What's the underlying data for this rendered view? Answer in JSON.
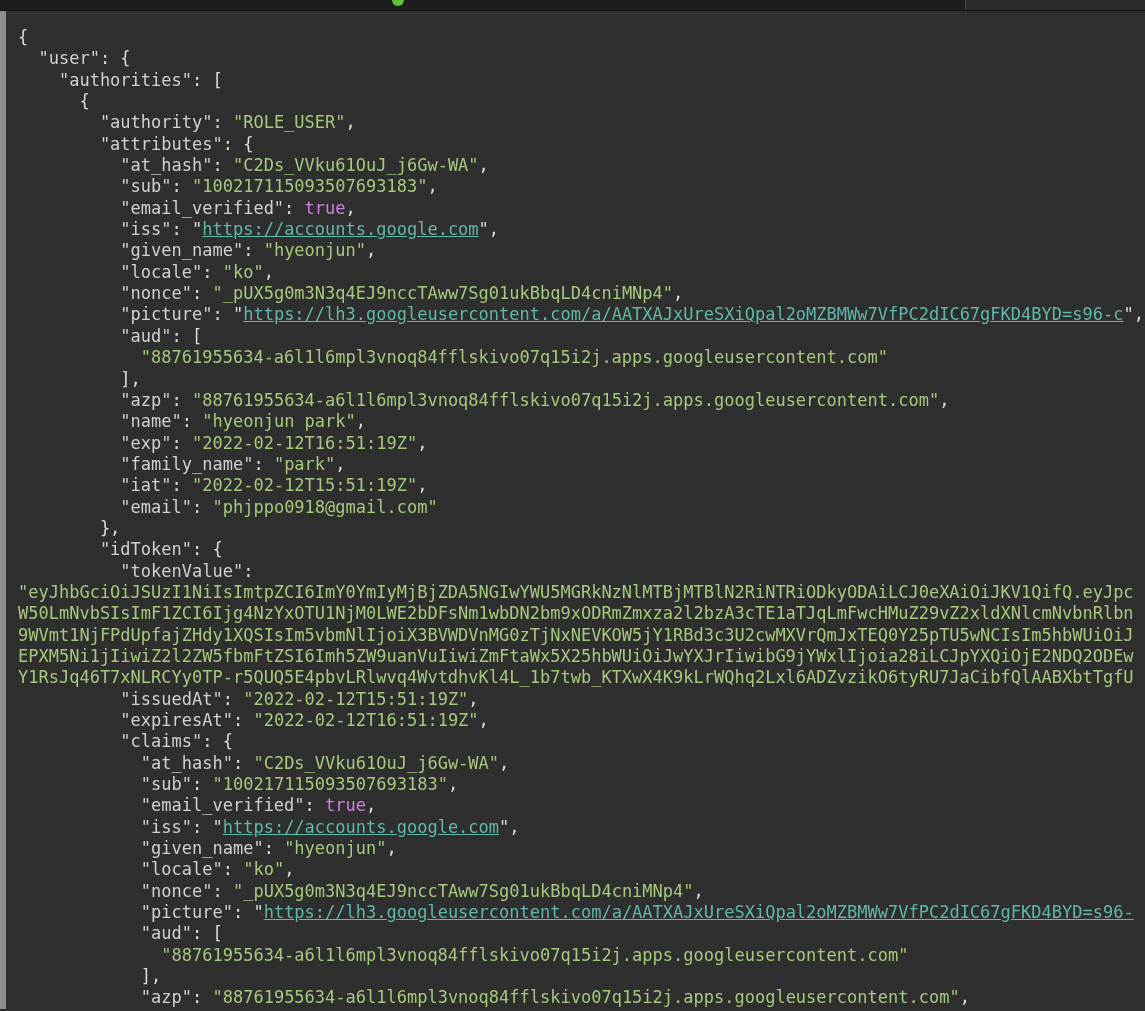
{
  "viewer": {
    "lines": [
      {
        "parts": [
          {
            "kind": "punct",
            "text": "{"
          }
        ],
        "children": [
          {
            "parts": [
              {
                "kind": "key",
                "text": "\"user\""
              },
              {
                "kind": "punct",
                "text": ": {"
              }
            ],
            "children": [
              {
                "parts": [
                  {
                    "kind": "key",
                    "text": "\"authorities\""
                  },
                  {
                    "kind": "punct",
                    "text": ": ["
                  }
                ],
                "children": [
                  {
                    "parts": [
                      {
                        "kind": "punct",
                        "text": "{"
                      }
                    ],
                    "children": [
                      {
                        "parts": [
                          {
                            "kind": "key",
                            "text": "\"authority\""
                          },
                          {
                            "kind": "punct",
                            "text": ": "
                          },
                          {
                            "kind": "string",
                            "text": "\"ROLE_USER\""
                          },
                          {
                            "kind": "punct",
                            "text": ","
                          }
                        ]
                      },
                      {
                        "parts": [
                          {
                            "kind": "key",
                            "text": "\"attributes\""
                          },
                          {
                            "kind": "punct",
                            "text": ": {"
                          }
                        ],
                        "children": [
                          {
                            "parts": [
                              {
                                "kind": "key",
                                "text": "\"at_hash\""
                              },
                              {
                                "kind": "punct",
                                "text": ": "
                              },
                              {
                                "kind": "string",
                                "text": "\"C2Ds_VVku61OuJ_j6Gw-WA\""
                              },
                              {
                                "kind": "punct",
                                "text": ","
                              }
                            ]
                          },
                          {
                            "parts": [
                              {
                                "kind": "key",
                                "text": "\"sub\""
                              },
                              {
                                "kind": "punct",
                                "text": ": "
                              },
                              {
                                "kind": "string",
                                "text": "\"100217115093507693183\""
                              },
                              {
                                "kind": "punct",
                                "text": ","
                              }
                            ]
                          },
                          {
                            "parts": [
                              {
                                "kind": "key",
                                "text": "\"email_verified\""
                              },
                              {
                                "kind": "punct",
                                "text": ": "
                              },
                              {
                                "kind": "bool",
                                "text": "true"
                              },
                              {
                                "kind": "punct",
                                "text": ","
                              }
                            ]
                          },
                          {
                            "parts": [
                              {
                                "kind": "key",
                                "text": "\"iss\""
                              },
                              {
                                "kind": "punct",
                                "text": ": \""
                              },
                              {
                                "kind": "link",
                                "text": "https://accounts.google.com"
                              },
                              {
                                "kind": "punct",
                                "text": "\","
                              }
                            ]
                          },
                          {
                            "parts": [
                              {
                                "kind": "key",
                                "text": "\"given_name\""
                              },
                              {
                                "kind": "punct",
                                "text": ": "
                              },
                              {
                                "kind": "string",
                                "text": "\"hyeonjun\""
                              },
                              {
                                "kind": "punct",
                                "text": ","
                              }
                            ]
                          },
                          {
                            "parts": [
                              {
                                "kind": "key",
                                "text": "\"locale\""
                              },
                              {
                                "kind": "punct",
                                "text": ": "
                              },
                              {
                                "kind": "string",
                                "text": "\"ko\""
                              },
                              {
                                "kind": "punct",
                                "text": ","
                              }
                            ]
                          },
                          {
                            "parts": [
                              {
                                "kind": "key",
                                "text": "\"nonce\""
                              },
                              {
                                "kind": "punct",
                                "text": ": "
                              },
                              {
                                "kind": "string",
                                "text": "\"_pUX5g0m3N3q4EJ9nccTAww7Sg01ukBbqLD4cniMNp4\""
                              },
                              {
                                "kind": "punct",
                                "text": ","
                              }
                            ]
                          },
                          {
                            "parts": [
                              {
                                "kind": "key",
                                "text": "\"picture\""
                              },
                              {
                                "kind": "punct",
                                "text": ": \""
                              },
                              {
                                "kind": "link",
                                "text": "https://lh3.googleusercontent.com/a/AATXAJxUreSXiQpal2oMZBMWw7VfPC2dIC67gFKD4BYD=s96-c"
                              },
                              {
                                "kind": "punct",
                                "text": "\","
                              }
                            ]
                          },
                          {
                            "parts": [
                              {
                                "kind": "key",
                                "text": "\"aud\""
                              },
                              {
                                "kind": "punct",
                                "text": ": ["
                              }
                            ],
                            "children": [
                              {
                                "parts": [
                                  {
                                    "kind": "string",
                                    "text": "\"88761955634-a6l1l6mpl3vnoq84fflskivo07q15i2j.apps.googleusercontent.com\""
                                  }
                                ]
                              }
                            ],
                            "end": [
                              {
                                "kind": "punct",
                                "text": "],"
                              }
                            ]
                          },
                          {
                            "parts": [
                              {
                                "kind": "key",
                                "text": "\"azp\""
                              },
                              {
                                "kind": "punct",
                                "text": ": "
                              },
                              {
                                "kind": "string",
                                "text": "\"88761955634-a6l1l6mpl3vnoq84fflskivo07q15i2j.apps.googleusercontent.com\""
                              },
                              {
                                "kind": "punct",
                                "text": ","
                              }
                            ]
                          },
                          {
                            "parts": [
                              {
                                "kind": "key",
                                "text": "\"name\""
                              },
                              {
                                "kind": "punct",
                                "text": ": "
                              },
                              {
                                "kind": "string",
                                "text": "\"hyeonjun park\""
                              },
                              {
                                "kind": "punct",
                                "text": ","
                              }
                            ]
                          },
                          {
                            "parts": [
                              {
                                "kind": "key",
                                "text": "\"exp\""
                              },
                              {
                                "kind": "punct",
                                "text": ": "
                              },
                              {
                                "kind": "string",
                                "text": "\"2022-02-12T16:51:19Z\""
                              },
                              {
                                "kind": "punct",
                                "text": ","
                              }
                            ]
                          },
                          {
                            "parts": [
                              {
                                "kind": "key",
                                "text": "\"family_name\""
                              },
                              {
                                "kind": "punct",
                                "text": ": "
                              },
                              {
                                "kind": "string",
                                "text": "\"park\""
                              },
                              {
                                "kind": "punct",
                                "text": ","
                              }
                            ]
                          },
                          {
                            "parts": [
                              {
                                "kind": "key",
                                "text": "\"iat\""
                              },
                              {
                                "kind": "punct",
                                "text": ": "
                              },
                              {
                                "kind": "string",
                                "text": "\"2022-02-12T15:51:19Z\""
                              },
                              {
                                "kind": "punct",
                                "text": ","
                              }
                            ]
                          },
                          {
                            "parts": [
                              {
                                "kind": "key",
                                "text": "\"email\""
                              },
                              {
                                "kind": "punct",
                                "text": ": "
                              },
                              {
                                "kind": "string",
                                "text": "\"phjppo0918@gmail.com\""
                              }
                            ]
                          }
                        ],
                        "end": [
                          {
                            "kind": "punct",
                            "text": "},"
                          }
                        ]
                      },
                      {
                        "parts": [
                          {
                            "kind": "key",
                            "text": "\"idToken\""
                          },
                          {
                            "kind": "punct",
                            "text": ": {"
                          }
                        ],
                        "children": [
                          {
                            "parts": [
                              {
                                "kind": "key",
                                "text": "\"tokenValue\""
                              },
                              {
                                "kind": "punct",
                                "text": ":"
                              }
                            ],
                            "wrapped": [
                              "\"eyJhbGciOiJSUzI1NiIsImtpZCI6ImY0YmIyMjBjZDA5NGIwYWU5MGRkNzNlMTBjMTBlN2RiNTRiODkyODAiLCJ0eXAiOiJKV1QifQ.eyJpc",
                              "W50LmNvbSIsImF1ZCI6Ijg4NzYxOTU1NjM0LWE2bDFsNm1wbDN2bm9xODRmZmxza2l2bzA3cTE1aTJqLmFwcHMuZ29vZ2xldXNlcmNvbnRlbn",
                              "9WVmt1NjFPdUpfajZHdy1XQSIsIm5vbmNlIjoiX3BVWDVnMG0zTjNxNEVKOW5jY1RBd3c3U2cwMXVrQmJxTEQ0Y25pTU5wNCIsIm5hbWUiOiJ",
                              "EPXM5Ni1jIiwiZ2l2ZW5fbmFtZSI6Imh5ZW9uanVuIiwiZmFtaWx5X25hbWUiOiJwYXJrIiwibG9jYWxlIjoia28iLCJpYXQiOjE2NDQ2ODEw",
                              "Y1RsJq46T7xNLRCYy0TP-r5QUQ5E4pbvLRlwvq4WvtdhvKl4L_1b7twb_KTXwX4K9kLrWQhq2Lxl6ADZvzikO6tyRU7JaCibfQlAABXbtTgfU"
                            ]
                          },
                          {
                            "parts": [
                              {
                                "kind": "key",
                                "text": "\"issuedAt\""
                              },
                              {
                                "kind": "punct",
                                "text": ": "
                              },
                              {
                                "kind": "string",
                                "text": "\"2022-02-12T15:51:19Z\""
                              },
                              {
                                "kind": "punct",
                                "text": ","
                              }
                            ]
                          },
                          {
                            "parts": [
                              {
                                "kind": "key",
                                "text": "\"expiresAt\""
                              },
                              {
                                "kind": "punct",
                                "text": ": "
                              },
                              {
                                "kind": "string",
                                "text": "\"2022-02-12T16:51:19Z\""
                              },
                              {
                                "kind": "punct",
                                "text": ","
                              }
                            ]
                          },
                          {
                            "parts": [
                              {
                                "kind": "key",
                                "text": "\"claims\""
                              },
                              {
                                "kind": "punct",
                                "text": ": {"
                              }
                            ],
                            "children": [
                              {
                                "parts": [
                                  {
                                    "kind": "key",
                                    "text": "\"at_hash\""
                                  },
                                  {
                                    "kind": "punct",
                                    "text": ": "
                                  },
                                  {
                                    "kind": "string",
                                    "text": "\"C2Ds_VVku61OuJ_j6Gw-WA\""
                                  },
                                  {
                                    "kind": "punct",
                                    "text": ","
                                  }
                                ]
                              },
                              {
                                "parts": [
                                  {
                                    "kind": "key",
                                    "text": "\"sub\""
                                  },
                                  {
                                    "kind": "punct",
                                    "text": ": "
                                  },
                                  {
                                    "kind": "string",
                                    "text": "\"100217115093507693183\""
                                  },
                                  {
                                    "kind": "punct",
                                    "text": ","
                                  }
                                ]
                              },
                              {
                                "parts": [
                                  {
                                    "kind": "key",
                                    "text": "\"email_verified\""
                                  },
                                  {
                                    "kind": "punct",
                                    "text": ": "
                                  },
                                  {
                                    "kind": "bool",
                                    "text": "true"
                                  },
                                  {
                                    "kind": "punct",
                                    "text": ","
                                  }
                                ]
                              },
                              {
                                "parts": [
                                  {
                                    "kind": "key",
                                    "text": "\"iss\""
                                  },
                                  {
                                    "kind": "punct",
                                    "text": ": \""
                                  },
                                  {
                                    "kind": "link",
                                    "text": "https://accounts.google.com"
                                  },
                                  {
                                    "kind": "punct",
                                    "text": "\","
                                  }
                                ]
                              },
                              {
                                "parts": [
                                  {
                                    "kind": "key",
                                    "text": "\"given_name\""
                                  },
                                  {
                                    "kind": "punct",
                                    "text": ": "
                                  },
                                  {
                                    "kind": "string",
                                    "text": "\"hyeonjun\""
                                  },
                                  {
                                    "kind": "punct",
                                    "text": ","
                                  }
                                ]
                              },
                              {
                                "parts": [
                                  {
                                    "kind": "key",
                                    "text": "\"locale\""
                                  },
                                  {
                                    "kind": "punct",
                                    "text": ": "
                                  },
                                  {
                                    "kind": "string",
                                    "text": "\"ko\""
                                  },
                                  {
                                    "kind": "punct",
                                    "text": ","
                                  }
                                ]
                              },
                              {
                                "parts": [
                                  {
                                    "kind": "key",
                                    "text": "\"nonce\""
                                  },
                                  {
                                    "kind": "punct",
                                    "text": ": "
                                  },
                                  {
                                    "kind": "string",
                                    "text": "\"_pUX5g0m3N3q4EJ9nccTAww7Sg01ukBbqLD4cniMNp4\""
                                  },
                                  {
                                    "kind": "punct",
                                    "text": ","
                                  }
                                ]
                              },
                              {
                                "parts": [
                                  {
                                    "kind": "key",
                                    "text": "\"picture\""
                                  },
                                  {
                                    "kind": "punct",
                                    "text": ": \""
                                  },
                                  {
                                    "kind": "link",
                                    "text": "https://lh3.googleusercontent.com/a/AATXAJxUreSXiQpal2oMZBMWw7VfPC2dIC67gFKD4BYD=s96-"
                                  }
                                ]
                              },
                              {
                                "parts": [
                                  {
                                    "kind": "key",
                                    "text": "\"aud\""
                                  },
                                  {
                                    "kind": "punct",
                                    "text": ": ["
                                  }
                                ],
                                "children": [
                                  {
                                    "parts": [
                                      {
                                        "kind": "string",
                                        "text": "\"88761955634-a6l1l6mpl3vnoq84fflskivo07q15i2j.apps.googleusercontent.com\""
                                      }
                                    ]
                                  }
                                ],
                                "end": [
                                  {
                                    "kind": "punct",
                                    "text": "],"
                                  }
                                ]
                              },
                              {
                                "parts": [
                                  {
                                    "kind": "key",
                                    "text": "\"azp\""
                                  },
                                  {
                                    "kind": "punct",
                                    "text": ": "
                                  },
                                  {
                                    "kind": "string",
                                    "text": "\"88761955634-a6l1l6mpl3vnoq84fflskivo07q15i2j.apps.googleusercontent.com\""
                                  },
                                  {
                                    "kind": "punct",
                                    "text": ","
                                  }
                                ]
                              }
                            ]
                          }
                        ]
                      }
                    ]
                  }
                ]
              }
            ]
          }
        ]
      }
    ]
  }
}
